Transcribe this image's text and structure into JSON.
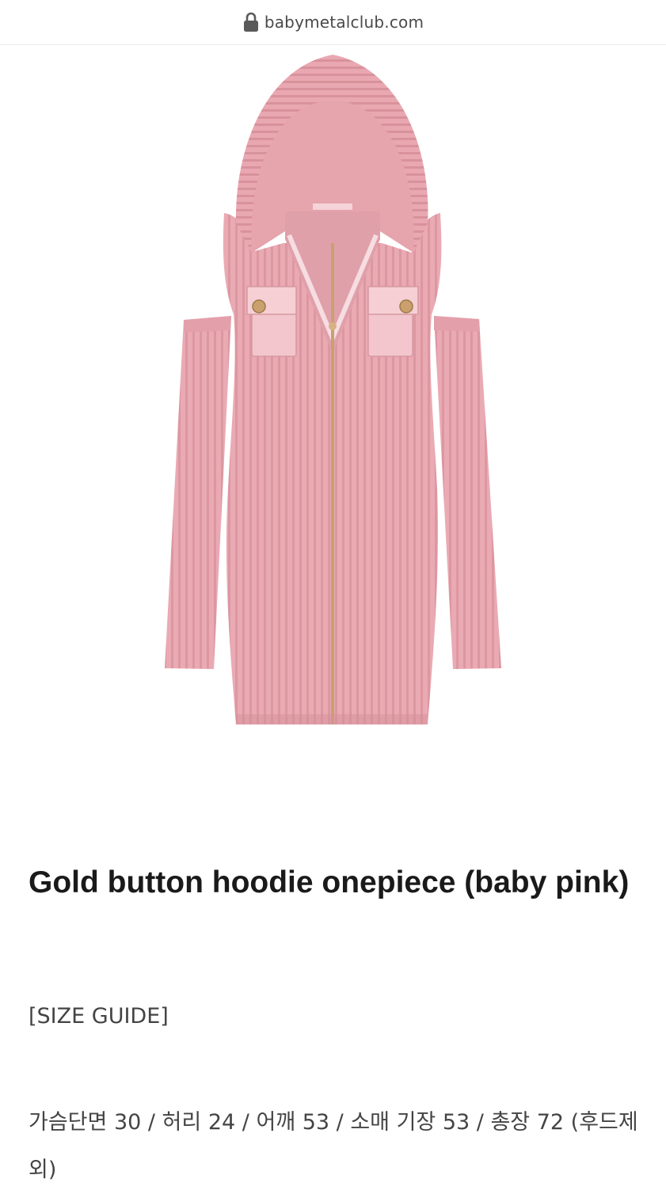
{
  "browser": {
    "url": "babymetalclub.com",
    "lock_icon": "lock-icon"
  },
  "product": {
    "image_icon": "pink-hoodie-dress-photo",
    "title": "Gold button hoodie onepiece (baby pink)",
    "size_guide_heading": "[SIZE GUIDE]",
    "size_guide_text": "가슴단면 30 / 허리 24 / 어깨 53 / 소매 기장 53 / 총장 72 (후드제외)"
  },
  "colors": {
    "dress_pink": "#e8a9b2",
    "dress_shadow": "#d48f9a",
    "zipper_gold": "#c9a070"
  }
}
